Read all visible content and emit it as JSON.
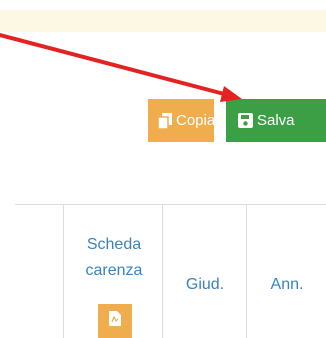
{
  "toolbar": {
    "copy_label": "Copia",
    "save_label": "Salva",
    "copy_icon": "copy-icon",
    "save_icon": "floppy-disk-icon"
  },
  "table": {
    "headers": {
      "scheda_line1": "Scheda",
      "scheda_line2": "carenza",
      "giud": "Giud.",
      "ann": "Ann."
    },
    "scheda_button_icon": "pdf-file-icon"
  },
  "colors": {
    "warning_bg": "#fcf8e3",
    "copy_button": "#f0ad4e",
    "save_button": "#3c9e45",
    "link_text": "#3a83c0",
    "annotation_arrow": "#e52222"
  }
}
